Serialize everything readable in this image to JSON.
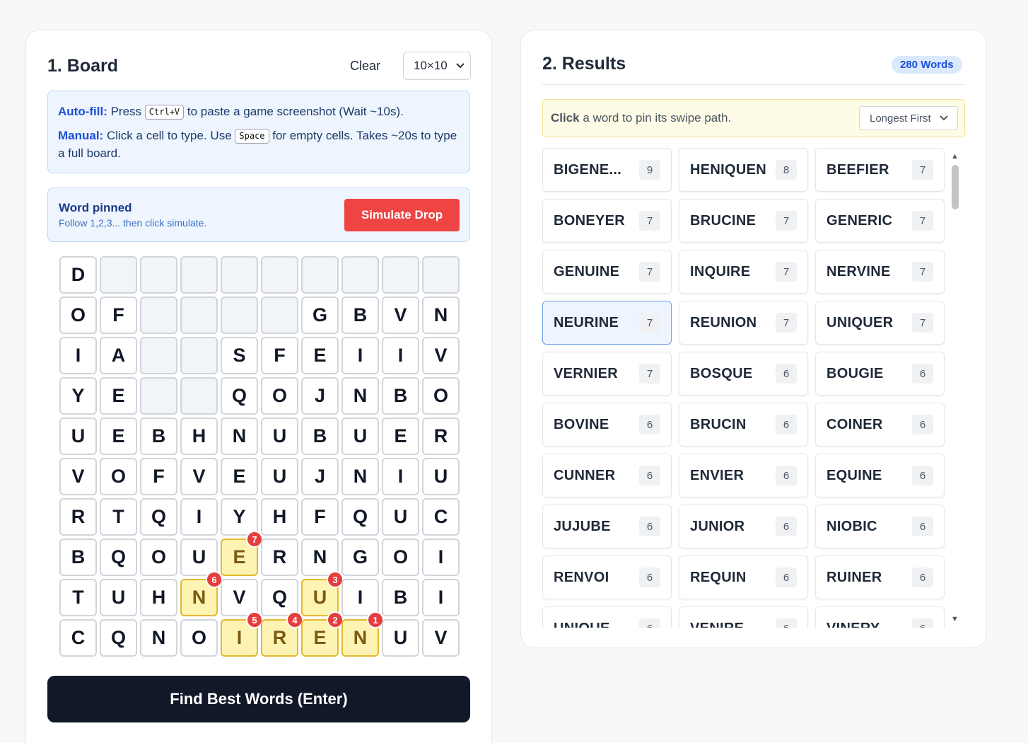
{
  "board": {
    "title": "1. Board",
    "clear_label": "Clear",
    "size_value": "10×10",
    "autofill_label": "Auto-fill:",
    "autofill_press": "Press",
    "autofill_key": "Ctrl+V",
    "autofill_rest": "to paste a game screenshot (Wait ~10s).",
    "manual_label": "Manual:",
    "manual_text1": "Click a cell to type. Use",
    "manual_key": "Space",
    "manual_text2": "for empty cells. Takes ~20s to type a full board.",
    "pinned_title": "Word pinned",
    "pinned_sub": "Follow 1,2,3... then click simulate.",
    "simulate_label": "Simulate Drop",
    "find_label": "Find Best Words (Enter)",
    "grid": [
      [
        "D",
        "",
        "",
        "",
        "",
        "",
        "",
        "",
        "",
        ""
      ],
      [
        "O",
        "F",
        "",
        "",
        "",
        "",
        "G",
        "B",
        "V",
        "N"
      ],
      [
        "I",
        "A",
        "",
        "",
        "S",
        "F",
        "E",
        "I",
        "I",
        "V"
      ],
      [
        "Y",
        "E",
        "",
        "",
        "Q",
        "O",
        "J",
        "N",
        "B",
        "O"
      ],
      [
        "U",
        "E",
        "B",
        "H",
        "N",
        "U",
        "B",
        "U",
        "E",
        "R"
      ],
      [
        "V",
        "O",
        "F",
        "V",
        "E",
        "U",
        "J",
        "N",
        "I",
        "U"
      ],
      [
        "R",
        "T",
        "Q",
        "I",
        "Y",
        "H",
        "F",
        "Q",
        "U",
        "C"
      ],
      [
        "B",
        "Q",
        "O",
        "U",
        "E",
        "R",
        "N",
        "G",
        "O",
        "I"
      ],
      [
        "T",
        "U",
        "H",
        "N",
        "V",
        "Q",
        "U",
        "I",
        "B",
        "I"
      ],
      [
        "C",
        "Q",
        "N",
        "O",
        "I",
        "R",
        "E",
        "N",
        "U",
        "V"
      ]
    ],
    "path": [
      {
        "row": 9,
        "col": 7,
        "order": "1"
      },
      {
        "row": 9,
        "col": 6,
        "order": "2"
      },
      {
        "row": 8,
        "col": 6,
        "order": "3"
      },
      {
        "row": 9,
        "col": 5,
        "order": "4"
      },
      {
        "row": 9,
        "col": 4,
        "order": "5"
      },
      {
        "row": 8,
        "col": 3,
        "order": "6"
      },
      {
        "row": 7,
        "col": 4,
        "order": "7"
      }
    ]
  },
  "results": {
    "title": "2. Results",
    "count_label": "280 Words",
    "hint_bold": "Click",
    "hint_rest": " a word to pin its swipe path.",
    "sort_value": "Longest First",
    "selected_word": "NEURINE",
    "words": [
      {
        "word": "BIGENE...",
        "len": "9"
      },
      {
        "word": "HENIQUEN",
        "len": "8"
      },
      {
        "word": "BEEFIER",
        "len": "7"
      },
      {
        "word": "BONEYER",
        "len": "7"
      },
      {
        "word": "BRUCINE",
        "len": "7"
      },
      {
        "word": "GENERIC",
        "len": "7"
      },
      {
        "word": "GENUINE",
        "len": "7"
      },
      {
        "word": "INQUIRE",
        "len": "7"
      },
      {
        "word": "NERVINE",
        "len": "7"
      },
      {
        "word": "NEURINE",
        "len": "7"
      },
      {
        "word": "REUNION",
        "len": "7"
      },
      {
        "word": "UNIQUER",
        "len": "7"
      },
      {
        "word": "VERNIER",
        "len": "7"
      },
      {
        "word": "BOSQUE",
        "len": "6"
      },
      {
        "word": "BOUGIE",
        "len": "6"
      },
      {
        "word": "BOVINE",
        "len": "6"
      },
      {
        "word": "BRUCIN",
        "len": "6"
      },
      {
        "word": "COINER",
        "len": "6"
      },
      {
        "word": "CUNNER",
        "len": "6"
      },
      {
        "word": "ENVIER",
        "len": "6"
      },
      {
        "word": "EQUINE",
        "len": "6"
      },
      {
        "word": "JUJUBE",
        "len": "6"
      },
      {
        "word": "JUNIOR",
        "len": "6"
      },
      {
        "word": "NIOBIC",
        "len": "6"
      },
      {
        "word": "RENVOI",
        "len": "6"
      },
      {
        "word": "REQUIN",
        "len": "6"
      },
      {
        "word": "RUINER",
        "len": "6"
      },
      {
        "word": "UNIQUE",
        "len": "6"
      },
      {
        "word": "VENIRE",
        "len": "6"
      },
      {
        "word": "VINERY",
        "len": "6"
      }
    ]
  },
  "colors": {
    "accent": "#1d4ed8",
    "simulate": "#ef4444",
    "path_fill": "#fdf3b3",
    "badge": "#e53e3e",
    "primary_button": "#111827"
  }
}
